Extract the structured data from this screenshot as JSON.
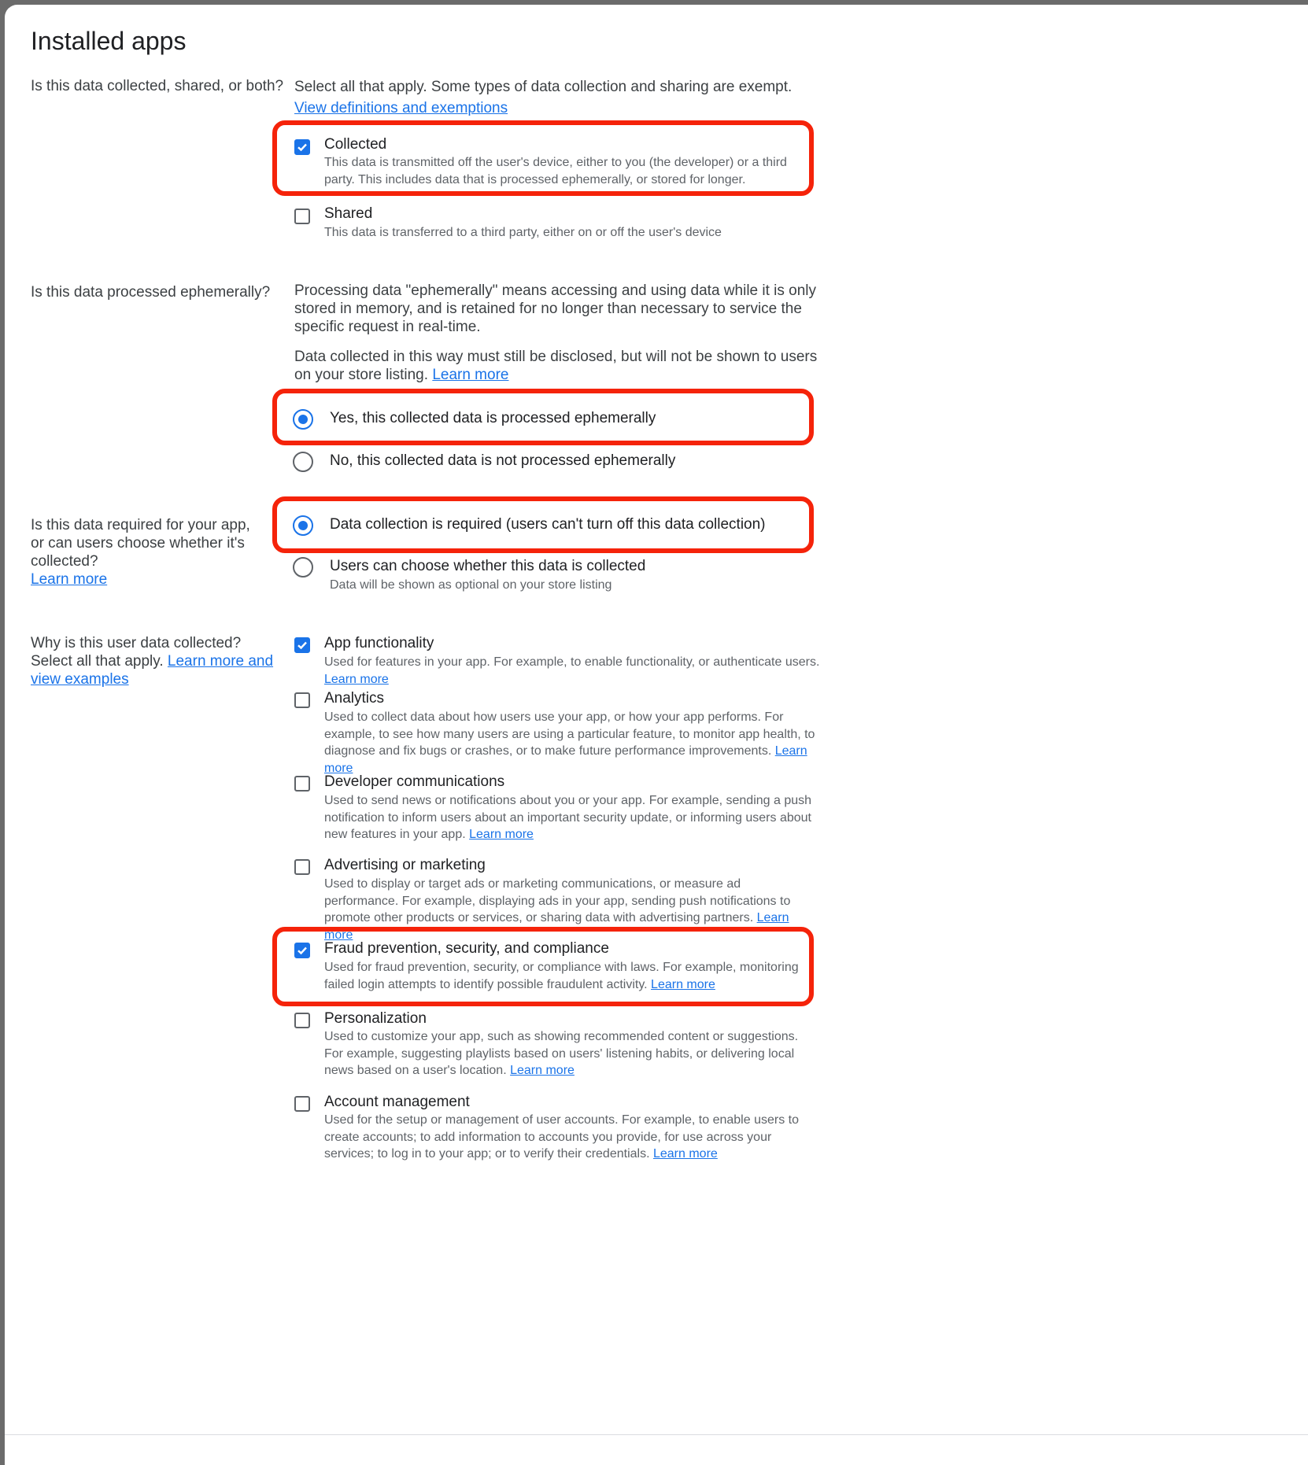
{
  "page_title": "Installed apps",
  "colors": {
    "accent": "#1a73e8",
    "highlight": "#f5230a"
  },
  "collected_shared": {
    "question": "Is this data collected, shared, or both?",
    "intro": "Select all that apply. Some types of data collection and sharing are exempt.",
    "intro_link": "View definitions and exemptions",
    "options": [
      {
        "label": "Collected",
        "desc": "This data is transmitted off the user's device, either to you (the developer) or a third party. This includes data that is processed ephemerally, or stored for longer.",
        "checked": true
      },
      {
        "label": "Shared",
        "desc": "This data is transferred to a third party, either on or off the user's device",
        "checked": false
      }
    ]
  },
  "ephemeral": {
    "question": "Is this data processed ephemerally?",
    "p1": "Processing data \"ephemerally\" means accessing and using data while it is only stored in memory, and is retained for no longer than necessary to service the specific request in real-time.",
    "p2": "Data collected in this way must still be disclosed, but will not be shown to users on your store listing.",
    "p2_link": "Learn more",
    "options": [
      {
        "label": "Yes, this collected data is processed ephemerally",
        "selected": true
      },
      {
        "label": "No, this collected data is not processed ephemerally",
        "selected": false
      }
    ]
  },
  "required": {
    "question": "Is this data required for your app, or can users choose whether it's collected?",
    "question_link": "Learn more",
    "options": [
      {
        "label": "Data collection is required (users can't turn off this data collection)",
        "selected": true,
        "desc": ""
      },
      {
        "label": "Users can choose whether this data is collected",
        "selected": false,
        "desc": "Data will be shown as optional on your store listing"
      }
    ]
  },
  "purpose": {
    "question": "Why is this user data collected? Select all that apply.",
    "question_link": "Learn more and view examples",
    "options": [
      {
        "label": "App functionality",
        "desc": "Used for features in your app. For example, to enable functionality, or authenticate users.",
        "link": "Learn more",
        "checked": true
      },
      {
        "label": "Analytics",
        "desc": "Used to collect data about how users use your app, or how your app performs. For example, to see how many users are using a particular feature, to monitor app health, to diagnose and fix bugs or crashes, or to make future performance improvements.",
        "link": "Learn more",
        "checked": false
      },
      {
        "label": "Developer communications",
        "desc": "Used to send news or notifications about you or your app. For example, sending a push notification to inform users about an important security update, or informing users about new features in your app.",
        "link": "Learn more",
        "checked": false
      },
      {
        "label": "Advertising or marketing",
        "desc": "Used to display or target ads or marketing communications, or measure ad performance. For example, displaying ads in your app, sending push notifications to promote other products or services, or sharing data with advertising partners.",
        "link": "Learn more",
        "checked": false
      },
      {
        "label": "Fraud prevention, security, and compliance",
        "desc": "Used for fraud prevention, security, or compliance with laws. For example, monitoring failed login attempts to identify possible fraudulent activity.",
        "link": "Learn more",
        "checked": true
      },
      {
        "label": "Personalization",
        "desc": "Used to customize your app, such as showing recommended content or suggestions. For example, suggesting playlists based on users' listening habits, or delivering local news based on a user's location.",
        "link": "Learn more",
        "checked": false
      },
      {
        "label": "Account management",
        "desc": "Used for the setup or management of user accounts. For example, to enable users to create accounts; to add information to accounts you provide, for use across your services; to log in to your app; or to verify their credentials.",
        "link": "Learn more",
        "checked": false
      }
    ]
  }
}
